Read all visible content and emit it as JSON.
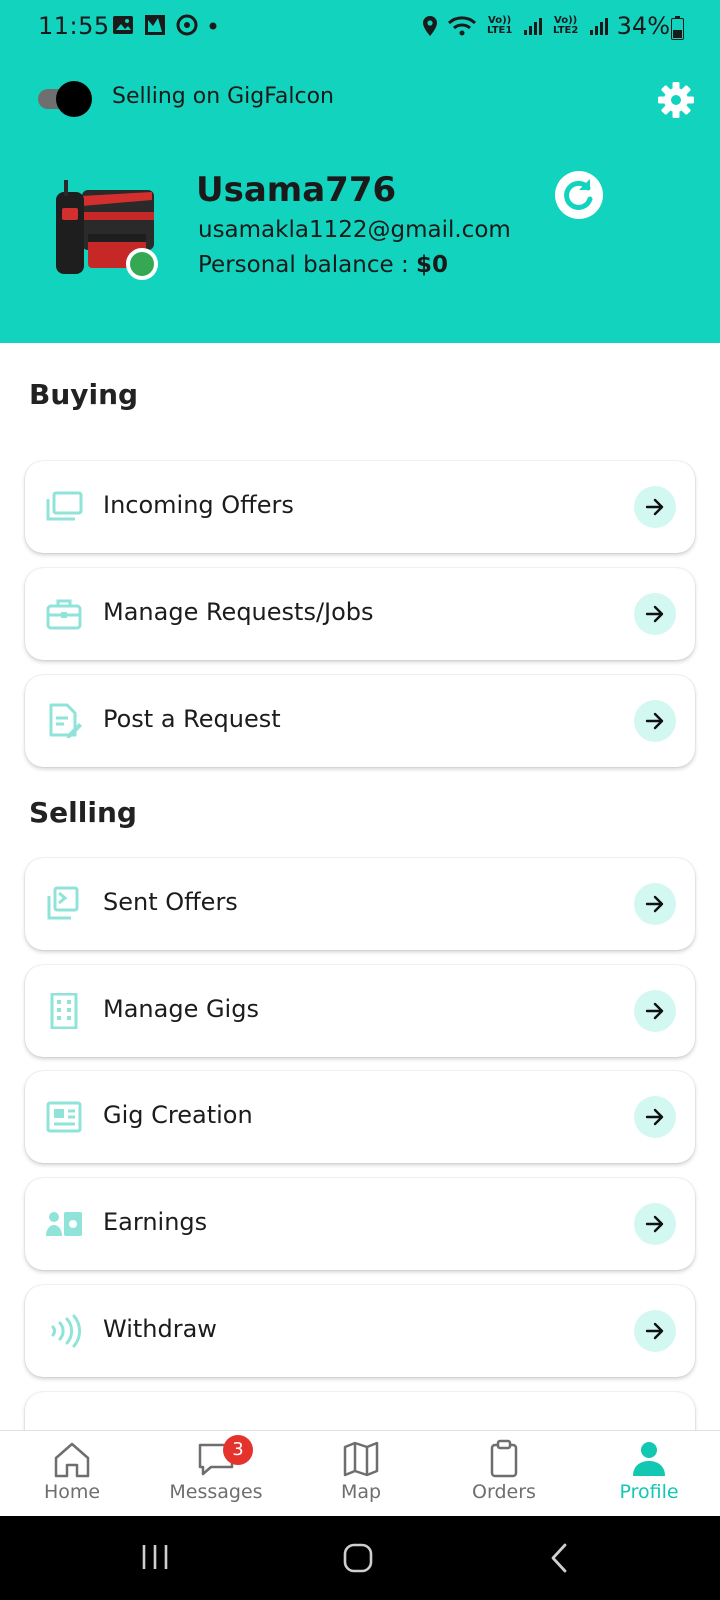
{
  "status_bar": {
    "time": "11:55",
    "lte1": "Vo)) LTE1",
    "lte2": "Vo)) LTE2",
    "battery": "34%"
  },
  "header": {
    "toggle_label": "Selling on GigFalcon",
    "toggle_on": true,
    "username": "Usama776",
    "email": "usamakla1122@gmail.com",
    "balance_label": "Personal balance :",
    "balance_value": "$0"
  },
  "sections": {
    "buying": {
      "title": "Buying",
      "items": [
        {
          "label": "Incoming Offers",
          "icon": "offers-icon"
        },
        {
          "label": "Manage Requests/Jobs",
          "icon": "briefcase-icon"
        },
        {
          "label": "Post a Request",
          "icon": "edit-document-icon"
        }
      ]
    },
    "selling": {
      "title": "Selling",
      "items": [
        {
          "label": "Sent Offers",
          "icon": "send-icon"
        },
        {
          "label": "Manage Gigs",
          "icon": "building-icon"
        },
        {
          "label": "Gig Creation",
          "icon": "news-card-icon"
        },
        {
          "label": "Earnings",
          "icon": "earnings-icon"
        },
        {
          "label": "Withdraw",
          "icon": "contactless-icon"
        }
      ]
    }
  },
  "bottom_nav": {
    "items": [
      {
        "label": "Home",
        "icon": "home-icon"
      },
      {
        "label": "Messages",
        "icon": "chat-icon",
        "badge": "3"
      },
      {
        "label": "Map",
        "icon": "map-icon"
      },
      {
        "label": "Orders",
        "icon": "clipboard-icon"
      },
      {
        "label": "Profile",
        "icon": "person-icon",
        "active": true
      }
    ]
  },
  "colors": {
    "accent": "#12d3bd",
    "arrow_bg": "#d3f7f1",
    "icon_tint": "#8fe3d8",
    "badge": "#e5322d",
    "online": "#35a853"
  }
}
